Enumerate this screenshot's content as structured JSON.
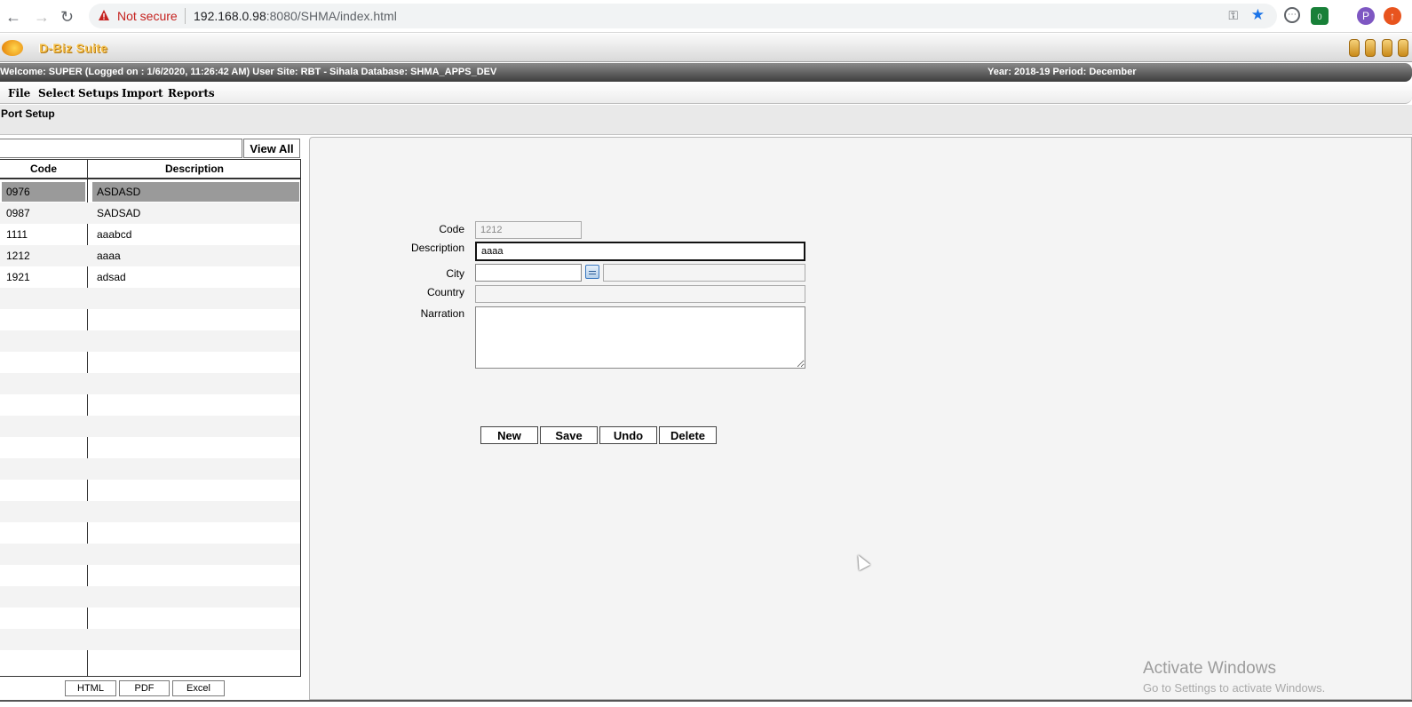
{
  "browser": {
    "not_secure": "Not secure",
    "url_host": "192.168.0.98",
    "url_rest": ":8080/SHMA/index.html",
    "profile_initial": "P",
    "ext_badge": "0"
  },
  "app": {
    "brand": "D-Biz Suite",
    "welcome": "Welcome: SUPER (Logged on : 1/6/2020, 11:26:42 AM) User Site: RBT - Sihala Database: SHMA_APPS_DEV",
    "period": "Year: 2018-19 Period: December",
    "menu": [
      "File",
      "Select",
      "Setups",
      "Import",
      "Reports"
    ],
    "page_title": "Port Setup"
  },
  "list": {
    "search_value": "",
    "view_all_label": "View All",
    "col_code": "Code",
    "col_description": "Description",
    "rows": [
      {
        "code": "0976",
        "description": "ASDASD"
      },
      {
        "code": "0987",
        "description": "SADSAD"
      },
      {
        "code": "1111",
        "description": "aaabcd"
      },
      {
        "code": "1212",
        "description": "aaaa"
      },
      {
        "code": "1921",
        "description": "adsad"
      }
    ],
    "export": [
      "HTML",
      "PDF",
      "Excel"
    ]
  },
  "form": {
    "code_label": "Code",
    "code_value": "1212",
    "description_label": "Description",
    "description_value": "aaaa",
    "city_label": "City",
    "city_code_value": "",
    "city_name_value": "",
    "country_label": "Country",
    "country_value": "",
    "narration_label": "Narration",
    "narration_value": "",
    "buttons": {
      "new": "New",
      "save": "Save",
      "undo": "Undo",
      "delete": "Delete"
    }
  },
  "os": {
    "activate_title": "Activate Windows",
    "activate_sub": "Go to Settings to activate Windows."
  }
}
